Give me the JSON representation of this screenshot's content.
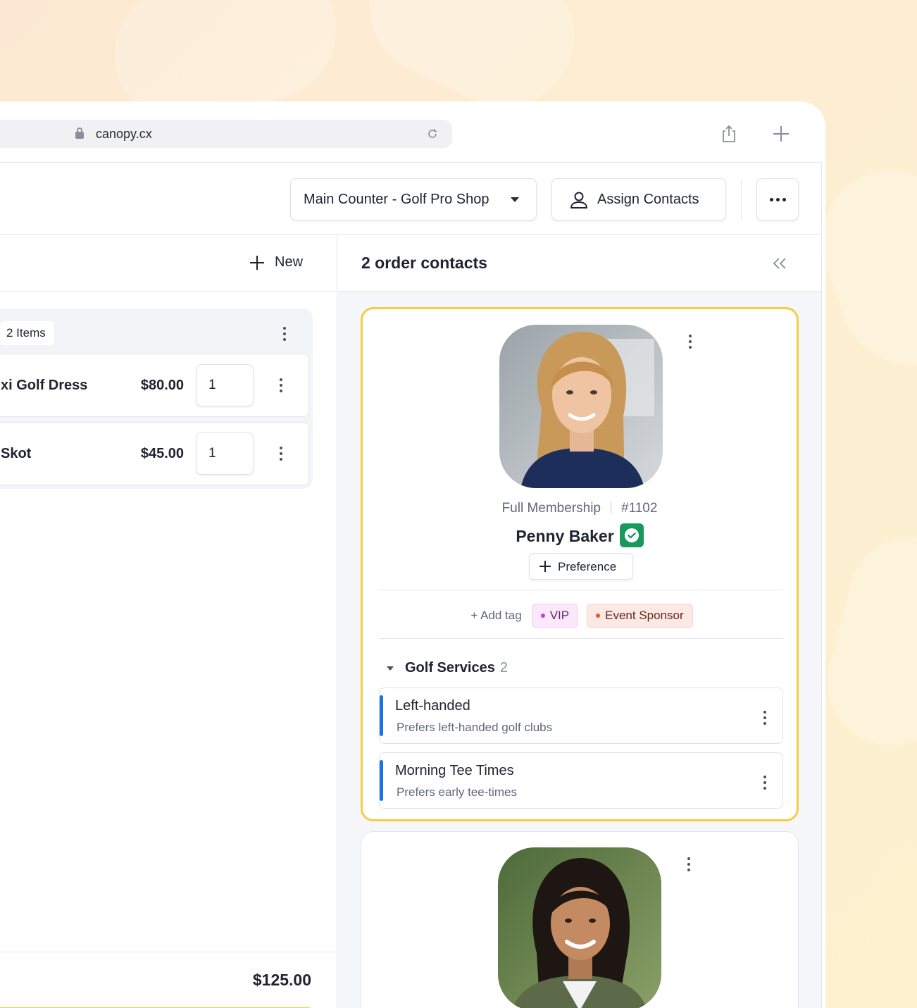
{
  "browser": {
    "url": "canopy.cx"
  },
  "header": {
    "location_select": "Main Counter - Golf Pro Shop",
    "assign_contacts_label": "Assign Contacts"
  },
  "order": {
    "new_label": "New",
    "items_count_label": "2 Items",
    "items": [
      {
        "name": "xi Golf Dress",
        "price": "$80.00",
        "qty": "1"
      },
      {
        "name": "Skot",
        "price": "$45.00",
        "qty": "1"
      }
    ],
    "total": "$125.00"
  },
  "contacts": {
    "title": "2 order contacts",
    "primary": {
      "membership": "Full Membership",
      "member_number": "#1102",
      "name": "Penny Baker",
      "preference_button": "Preference",
      "add_tag_label": "+ Add tag",
      "tags": [
        {
          "label": "VIP",
          "color": "#c33fd0"
        },
        {
          "label": "Event Sponsor",
          "color": "#e7533a"
        }
      ],
      "section_title": "Golf Services",
      "section_count": "2",
      "preferences": [
        {
          "title": "Left-handed",
          "subtitle": "Prefers left-handed golf clubs"
        },
        {
          "title": "Morning Tee Times",
          "subtitle": "Prefers early tee-times"
        }
      ]
    }
  },
  "colors": {
    "accent_yellow": "#f6cc45",
    "verified_green": "#169a5b",
    "preference_accent": "#1a73e8"
  }
}
